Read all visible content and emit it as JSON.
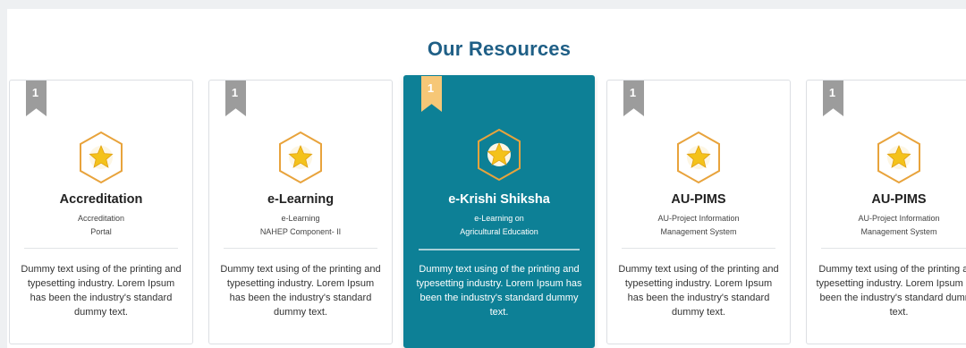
{
  "section": {
    "title": "Our Resources"
  },
  "cards": [
    {
      "rank": "1",
      "title": "Accreditation",
      "subtitle_line1": "Accreditation",
      "subtitle_line2": "Portal",
      "description": "Dummy text using of the printing and typesetting industry. Lorem Ipsum has been the industry's standard dummy text.",
      "icon": "star-hexagon-icon",
      "active": false
    },
    {
      "rank": "1",
      "title": "e-Learning",
      "subtitle_line1": "e-Learning",
      "subtitle_line2": "NAHEP Component- II",
      "description": "Dummy text using of the printing and typesetting industry. Lorem Ipsum has been the industry's standard dummy text.",
      "icon": "star-hexagon-icon",
      "active": false
    },
    {
      "rank": "1",
      "title": "e-Krishi Shiksha",
      "subtitle_line1": "e-Learning on",
      "subtitle_line2": "Agricultural Education",
      "description": "Dummy text using of the printing and typesetting industry. Lorem Ipsum has been the industry's standard dummy text.",
      "icon": "star-hexagon-icon",
      "active": true
    },
    {
      "rank": "1",
      "title": "AU-PIMS",
      "subtitle_line1": "AU-Project Information",
      "subtitle_line2": "Management System",
      "description": "Dummy text using of the printing and typesetting industry. Lorem Ipsum has been the industry's standard dummy text.",
      "icon": "star-hexagon-icon",
      "active": false
    },
    {
      "rank": "1",
      "title": "AU-PIMS",
      "subtitle_line1": "AU-Project Information",
      "subtitle_line2": "Management System",
      "description": "Dummy text using of the printing and typesetting industry. Lorem Ipsum has been the industry's standard dummy text.",
      "icon": "star-hexagon-icon",
      "active": false
    }
  ],
  "colors": {
    "title": "#1f5f86",
    "active_card": "#0d8096",
    "ribbon": "#9c9c9c",
    "ribbon_active": "#f6c777",
    "hexagon": "#e8a33c",
    "star": "#f4c21a"
  }
}
